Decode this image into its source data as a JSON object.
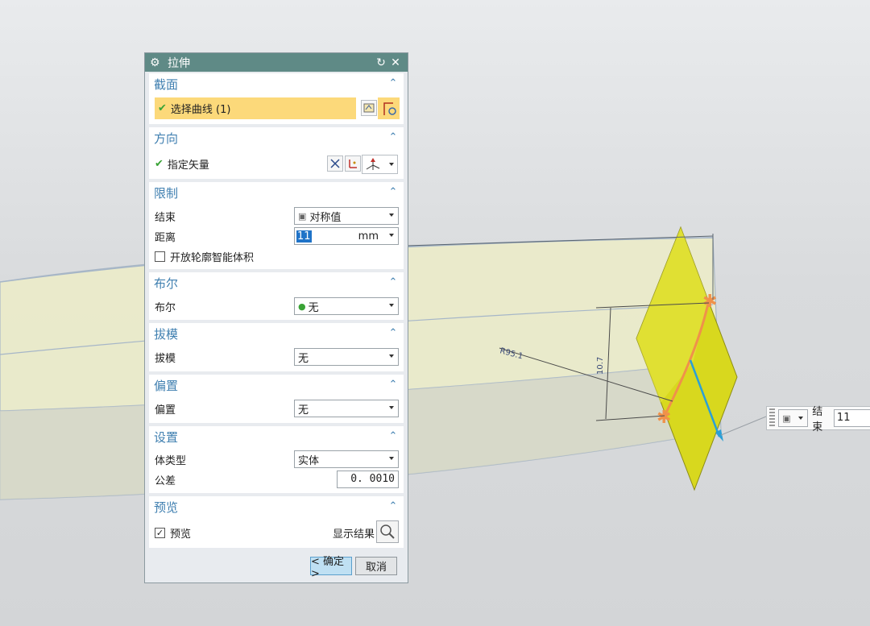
{
  "dialog": {
    "title": "拉伸",
    "sections": {
      "section": {
        "header": "截面",
        "select_curve": "选择曲线 (1)"
      },
      "direction": {
        "header": "方向",
        "specify_vector": "指定矢量"
      },
      "limits": {
        "header": "限制",
        "end_label": "结束",
        "end_value": "对称值",
        "distance_label": "距离",
        "distance_value": "11",
        "distance_unit": "mm",
        "open_profile_label": "开放轮廓智能体积"
      },
      "boolean": {
        "header": "布尔",
        "label": "布尔",
        "value": "无"
      },
      "draft": {
        "header": "拔模",
        "label": "拔模",
        "value": "无"
      },
      "offset": {
        "header": "偏置",
        "label": "偏置",
        "value": "无"
      },
      "settings": {
        "header": "设置",
        "body_type_label": "体类型",
        "body_type_value": "实体",
        "tolerance_label": "公差",
        "tolerance_value": "0. 0010"
      },
      "preview": {
        "header": "预览",
        "preview_label": "预览",
        "show_result_label": "显示结果"
      }
    },
    "buttons": {
      "ok": "< 确定 >",
      "cancel": "取消"
    }
  },
  "viewport": {
    "dim_radius": "R95.1",
    "dim_height": "10.7",
    "end_label": "结束",
    "end_value": "11"
  },
  "colors": {
    "title_bar": "#5f8a86",
    "section_header": "#3f7fb0",
    "selected_row": "#fcd97a",
    "surface_yellow": "#eeeec4",
    "sheet_yellow": "#d6d61c",
    "arc_orange": "#f0914a",
    "vector_blue": "#2b9fd6"
  }
}
